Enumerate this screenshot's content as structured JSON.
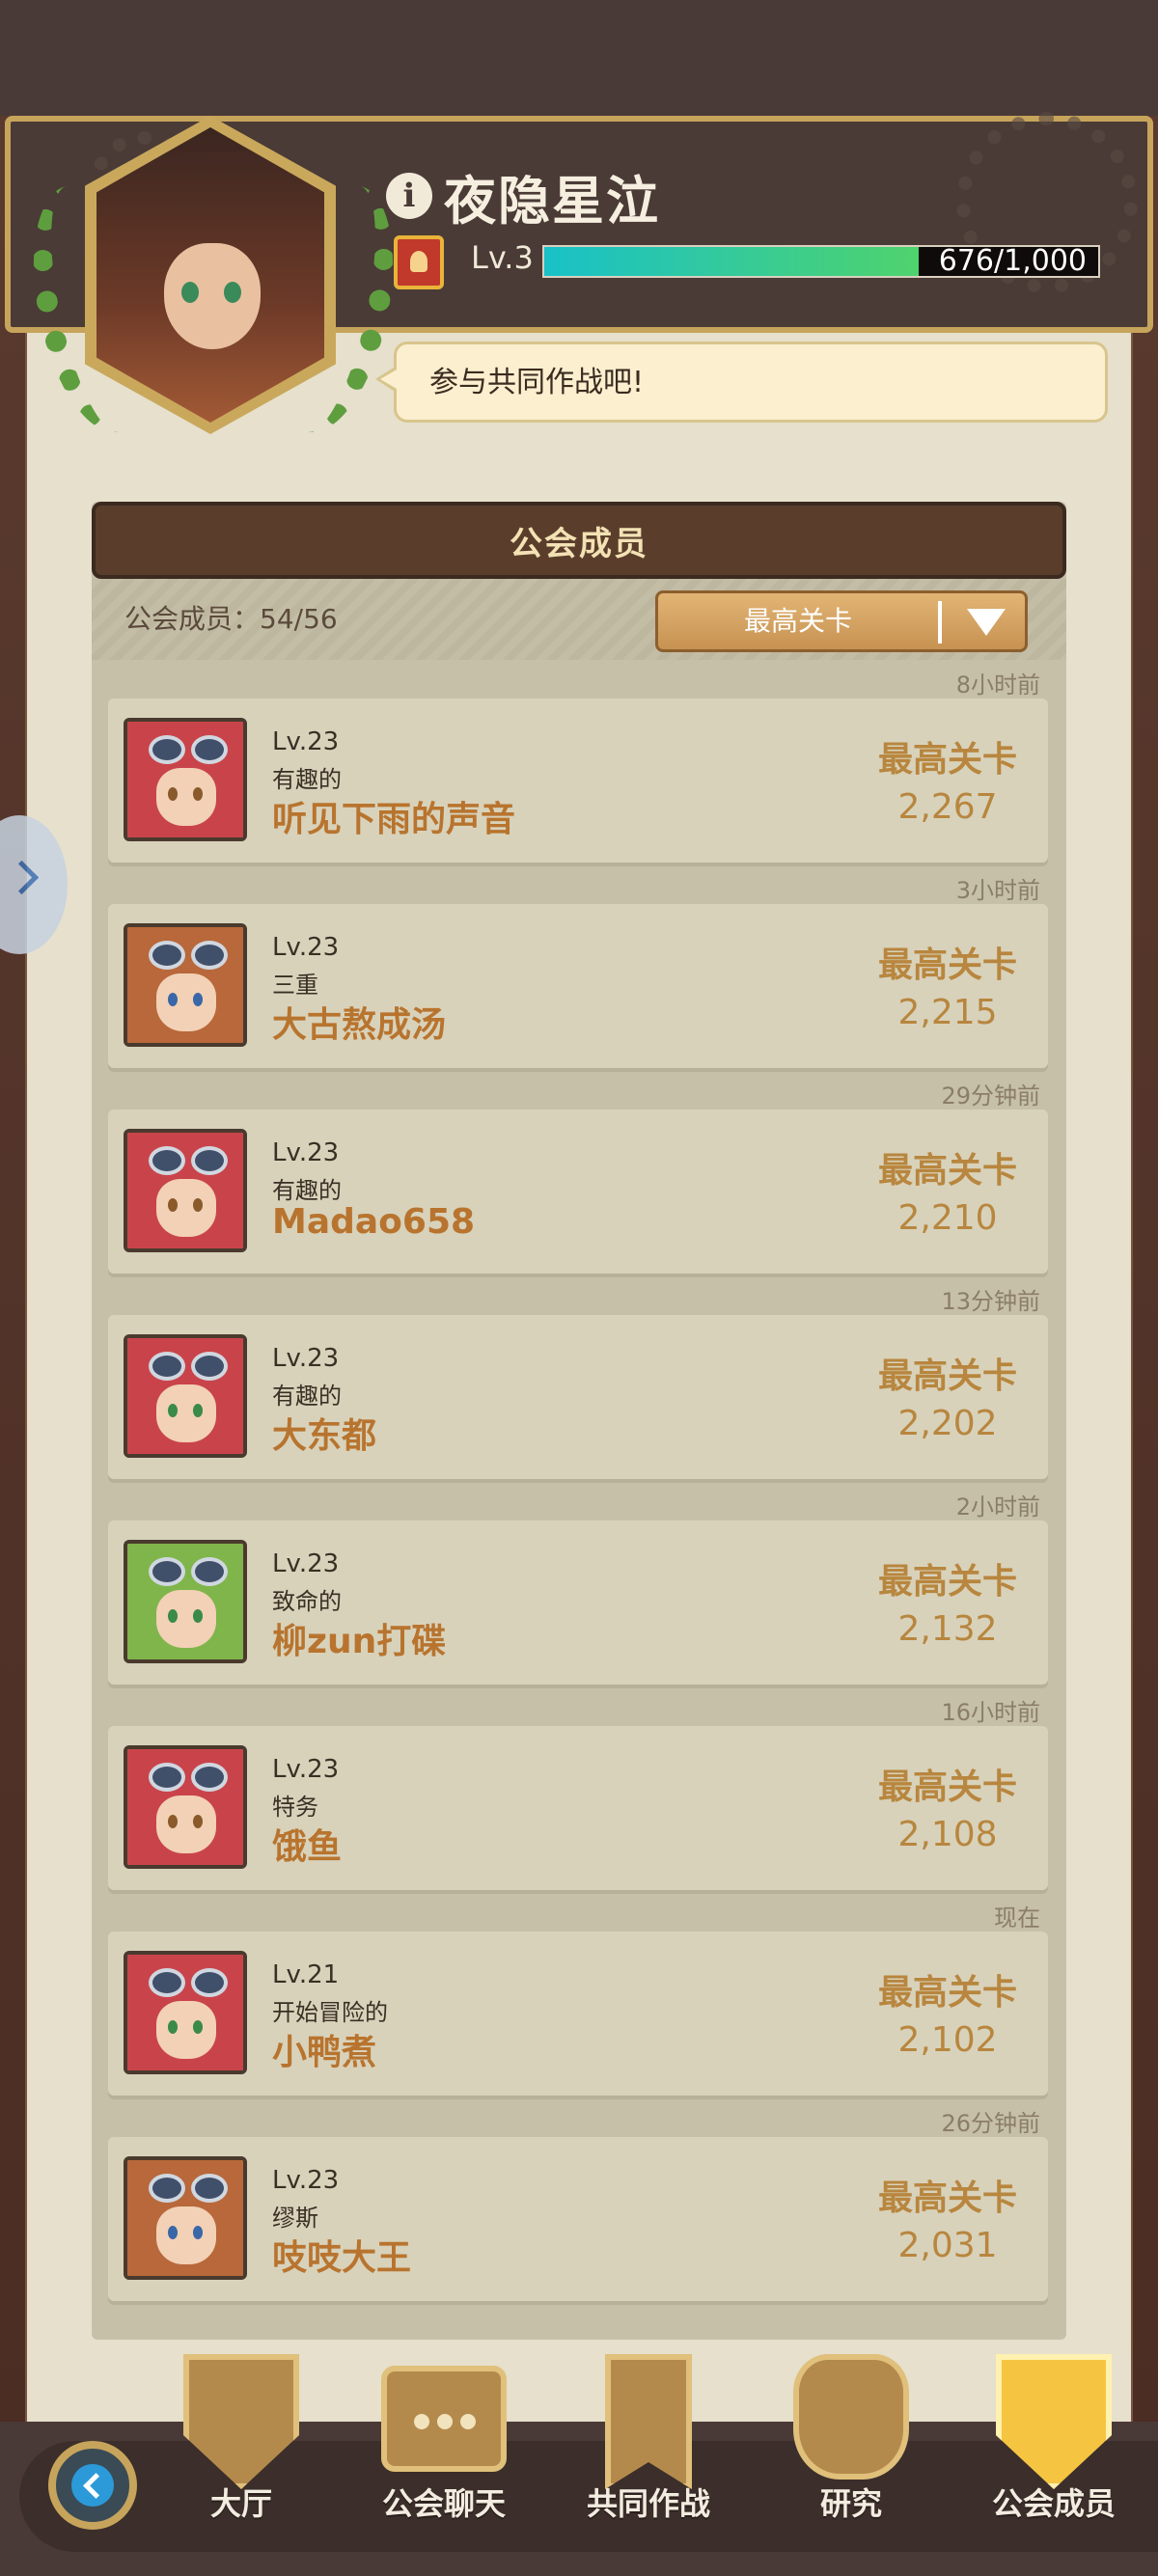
{
  "profile": {
    "info_icon": "i",
    "name": "夜隐星泣",
    "level_label": "Lv.3",
    "xp_text": "676/1,000",
    "xp_fraction": 0.676,
    "speech": "参与共同作战吧!"
  },
  "members_panel": {
    "title": "公会成员",
    "count_label": "公会成员：54/56",
    "sort_label": "最高关卡"
  },
  "members": [
    {
      "time": "8小时前",
      "level": "Lv.23",
      "title": "有趣的",
      "name": "听见下雨的声音",
      "stage_label": "最高关卡",
      "stage": "2,267",
      "hair": "#c9444a",
      "eye": "#8a5a2b"
    },
    {
      "time": "3小时前",
      "level": "Lv.23",
      "title": "三重",
      "name": "大古熬成汤",
      "stage_label": "最高关卡",
      "stage": "2,215",
      "hair": "#b8683a",
      "eye": "#3a67a8"
    },
    {
      "time": "29分钟前",
      "level": "Lv.23",
      "title": "有趣的",
      "name": "Madao658",
      "stage_label": "最高关卡",
      "stage": "2,210",
      "hair": "#c9444a",
      "eye": "#8a5a2b"
    },
    {
      "time": "13分钟前",
      "level": "Lv.23",
      "title": "有趣的",
      "name": "大东都",
      "stage_label": "最高关卡",
      "stage": "2,202",
      "hair": "#c9444a",
      "eye": "#3a8a4a"
    },
    {
      "time": "2小时前",
      "level": "Lv.23",
      "title": "致命的",
      "name": "柳zun打碟",
      "stage_label": "最高关卡",
      "stage": "2,132",
      "hair": "#7fb54a",
      "eye": "#3a8a4a"
    },
    {
      "time": "16小时前",
      "level": "Lv.23",
      "title": "特务",
      "name": "饿鱼",
      "stage_label": "最高关卡",
      "stage": "2,108",
      "hair": "#c9444a",
      "eye": "#8a5a2b"
    },
    {
      "time": "现在",
      "level": "Lv.21",
      "title": "开始冒险的",
      "name": "小鸭煮",
      "stage_label": "最高关卡",
      "stage": "2,102",
      "hair": "#c9444a",
      "eye": "#3a8a4a"
    },
    {
      "time": "26分钟前",
      "level": "Lv.23",
      "title": "缪斯",
      "name": "吱吱大王",
      "stage_label": "最高关卡",
      "stage": "2,031",
      "hair": "#b8683a",
      "eye": "#3a67a8"
    }
  ],
  "nav": {
    "hall": "大厅",
    "chat": "公会聊天",
    "coop": "共同作战",
    "research": "研究",
    "members": "公会成员"
  },
  "icons": {
    "info": "info-icon",
    "side": "chevron-right-icon",
    "back": "chevron-left-icon"
  }
}
